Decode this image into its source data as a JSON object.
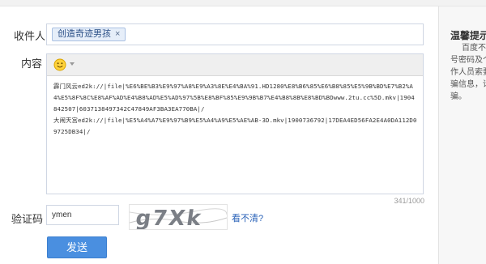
{
  "labels": {
    "recipient": "收件人",
    "content": "内容",
    "captcha": "验证码"
  },
  "recipient": {
    "chip": "创造奇迹男孩",
    "remove": "×"
  },
  "editor": {
    "emoji_icon": "smiley-icon",
    "lines": [
      "霹门风云ed2k://|file|%E6%BE%B3%E9%97%A8%E9%A3%8E%E4%BA%91.HD1280%E8%B6%85%E6%B8%85%E5%9B%BD%E7%B2%A4%E5%8F%8C%E8%AF%AD%E4%B8%AD%E5%AD%97%5B%E8%BF%85%E9%9B%B7%E4%B8%8B%E8%BD%BDwww.2tu.cc%5D.mkv|1904842507|6037138497342C47849AF3BA3EA770BA|/",
      "大闹天宫ed2k://|file|%E5%A4%A7%E9%97%B9%E5%A4%A9%E5%AE%AB-3D.mkv|1900736792|17DEA4ED56FA2E4A0DA112D09725DB34|/"
    ],
    "counter": "341/1000"
  },
  "captcha": {
    "value": "ymen",
    "image_text": "g7Xk",
    "refresh_link": "看不清?"
  },
  "send_button": "发送",
  "tips": {
    "title": "温馨提示",
    "lines": [
      "百度不",
      "号密码及个",
      "作人员索要",
      "骗信息，请",
      "骗。"
    ]
  },
  "colors": {
    "accent": "#4a8fe0",
    "link": "#2a62b8",
    "chip_bg": "#e6eef9"
  }
}
